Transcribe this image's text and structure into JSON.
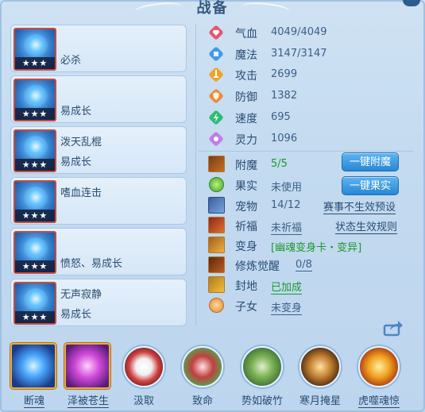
{
  "title": "战备",
  "skills_left": [
    {
      "name1": "",
      "name2": "必杀",
      "stars": "★★★"
    },
    {
      "name1": "",
      "name2": "易成长",
      "stars": "★★★"
    },
    {
      "name1": "泼天乱棍",
      "name2": "易成长",
      "stars": "★★★"
    },
    {
      "name1": "嗜血连击",
      "name2": "",
      "stars": "★★★"
    },
    {
      "name1": "",
      "name2": "愤怒、易成长",
      "stars": "★★★"
    },
    {
      "name1": "无声寂静",
      "name2": "易成长",
      "stars": "★★★"
    }
  ],
  "stats": [
    {
      "label": "气血",
      "value": "4049/4049",
      "color": "#e8566f",
      "icon": "heart-icon"
    },
    {
      "label": "魔法",
      "value": "3147/3147",
      "color": "#3f9be8",
      "icon": "mana-icon"
    },
    {
      "label": "攻击",
      "value": "2699",
      "color": "#f0a224",
      "icon": "attack-icon"
    },
    {
      "label": "防御",
      "value": "1382",
      "color": "#ef8a3a",
      "icon": "shield-icon"
    },
    {
      "label": "速度",
      "value": "695",
      "color": "#2bbf73",
      "icon": "speed-icon"
    },
    {
      "label": "灵力",
      "value": "1096",
      "color": "#c07ee6",
      "icon": "spirit-icon"
    }
  ],
  "rows": {
    "enchant": {
      "label": "附魔",
      "value": "5/5",
      "button": "一键附魔"
    },
    "fruit": {
      "label": "果实",
      "value": "未使用",
      "button": "一键果实"
    },
    "pet": {
      "label": "宠物",
      "value": "14/12",
      "link": "赛事不生效预设"
    },
    "blessing": {
      "label": "祈福",
      "value": "未祈福",
      "link": "状态生效规则"
    },
    "transform": {
      "label": "变身",
      "value": "[幽魂变身卡・变异]"
    },
    "awaken": {
      "label": "修炼觉醒",
      "value": "0/8"
    },
    "fief": {
      "label": "封地",
      "value": "已加成"
    },
    "child": {
      "label": "子女",
      "value": "未变身"
    }
  },
  "bottom_skills": [
    {
      "label": "断魂",
      "underline": true
    },
    {
      "label": "泽被苍生",
      "underline": true
    },
    {
      "label": "汲取",
      "underline": false
    },
    {
      "label": "致命",
      "underline": false
    },
    {
      "label": "势如破竹",
      "underline": false
    },
    {
      "label": "寒月掩星",
      "underline": false
    },
    {
      "label": "虎噬魂惊",
      "underline": true
    }
  ]
}
